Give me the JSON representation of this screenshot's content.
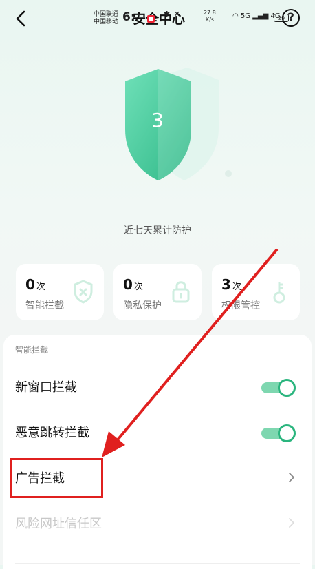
{
  "status_bar": {
    "carrier_1": "中国联通",
    "carrier_2": "中国移动",
    "time": "6:",
    "net_speed_value": "27.8",
    "net_speed_unit": "K/s",
    "network_1": "5G",
    "network_2": "4G",
    "battery": "29"
  },
  "header": {
    "title": "安全中心"
  },
  "hero": {
    "count": "3",
    "caption": "近七天累计防护"
  },
  "stats": [
    {
      "value": "0",
      "unit": "次",
      "label": "智能拦截",
      "icon": "shield-x-icon"
    },
    {
      "value": "0",
      "unit": "次",
      "label": "隐私保护",
      "icon": "lock-icon"
    },
    {
      "value": "3",
      "unit": "次",
      "label": "权限管控",
      "icon": "key-icon"
    }
  ],
  "section": {
    "title": "智能拦截",
    "rows": [
      {
        "label": "新窗口拦截",
        "control": "toggle",
        "on": true
      },
      {
        "label": "恶意跳转拦截",
        "control": "toggle",
        "on": true
      },
      {
        "label": "广告拦截",
        "control": "chevron"
      },
      {
        "label": "风险网址信任区",
        "control": "chevron",
        "disabled": true
      }
    ]
  },
  "colors": {
    "accent": "#2ab57e",
    "accent_light": "#7ed7b0",
    "annotation": "#e0201f"
  }
}
